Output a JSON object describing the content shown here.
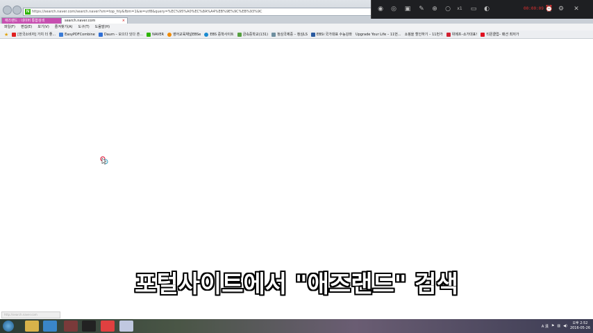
{
  "browser": {
    "address_url": "https://search.naver.com/search.naver?sm=top_hty&fbm=1&ie=utf8&query=%EC%95%A0%EC%8A%A4%EB%9E%9C%EB%93%9C",
    "tabs": [
      {
        "label": "애즈랜드 : 네이버 통합검색"
      },
      {
        "label": "search.naver.com"
      }
    ],
    "menu": [
      "파일(F)",
      "편집(E)",
      "보기(V)",
      "즐겨찾기(A)",
      "도구(T)",
      "도움말(H)"
    ],
    "favorites": [
      {
        "label": "[한국소비자] 가치 더 좋...",
        "color": "#e02020"
      },
      {
        "label": "EasyPDFCombine",
        "color": "#3a7bd5"
      },
      {
        "label": "Daum – 모으다 잇다 흔...",
        "color": "#2f6fd6"
      },
      {
        "label": "NAVER",
        "color": "#2db400"
      },
      {
        "label": "영어교육채널EBSe",
        "color": "#f08a00"
      },
      {
        "label": "EBS 중학사이트",
        "color": "#1a8ad0"
      },
      {
        "label": "금속중학교(131)",
        "color": "#55a040"
      },
      {
        "label": "청심국제중 – 청심LS",
        "color": "#6f8fa0"
      },
      {
        "label": "EBSi 국가대표 수능강좌",
        "color": "#2a5aa0"
      },
      {
        "label": "Upgrade Your Life – 11번...",
        "color": ""
      },
      {
        "label": "쇼핑을 할인하기 – 11번가",
        "color": ""
      },
      {
        "label": "위메프–쇼가대표!",
        "color": "#d02030"
      },
      {
        "label": "티몬클럽– 패션 최저가",
        "color": "#e01020"
      }
    ]
  },
  "recorder": {
    "timer": "00:00:09"
  },
  "page": {
    "caption": "포털사이트에서 \"애즈랜드\" 검색",
    "status_text": "http://search.naver.com"
  },
  "taskbar": {
    "time": "오후 2:52",
    "date": "2016-05-26",
    "ime": "A 漢"
  },
  "colors": {
    "active_tab": "#c74fb0",
    "recorder_bg": "#1e1f22",
    "timer": "#e03030"
  }
}
